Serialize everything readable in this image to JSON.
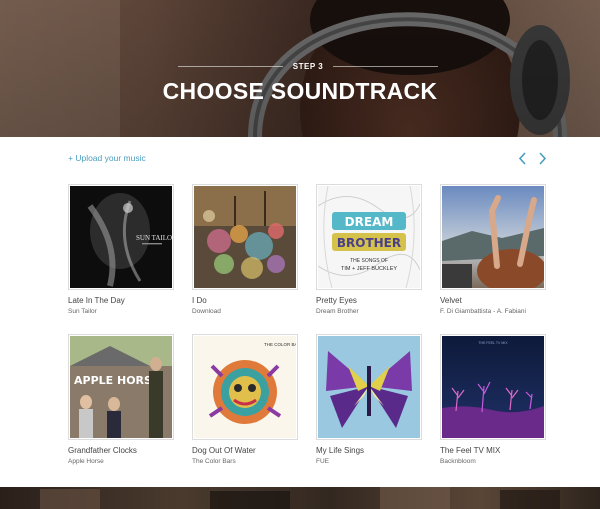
{
  "hero": {
    "step": "STEP 3",
    "title": "CHOOSE SOUNDTRACK"
  },
  "toolbar": {
    "upload_label": "+ Upload your music",
    "prev_icon": "chevron-left-icon",
    "next_icon": "chevron-right-icon",
    "accent_color": "#4a9ec0"
  },
  "albums": [
    {
      "title": "Late In The Day",
      "artist": "Sun Tailor",
      "cover_text": "SUN TAILOR"
    },
    {
      "title": "I Do",
      "artist": "Download"
    },
    {
      "title": "Pretty Eyes",
      "artist": "Dream Brother",
      "cover_text": "DREAM BROTHER"
    },
    {
      "title": "Velvet",
      "artist": "F. Di Giambattista - A. Fabiani"
    },
    {
      "title": "Grandfather Clocks",
      "artist": "Apple Horse",
      "cover_text": "APPLE HORSE"
    },
    {
      "title": "Dog Out Of Water",
      "artist": "The Color Bars"
    },
    {
      "title": "My Life Sings",
      "artist": "FUE"
    },
    {
      "title": "The Feel TV MIX",
      "artist": "Backnbloom"
    }
  ]
}
